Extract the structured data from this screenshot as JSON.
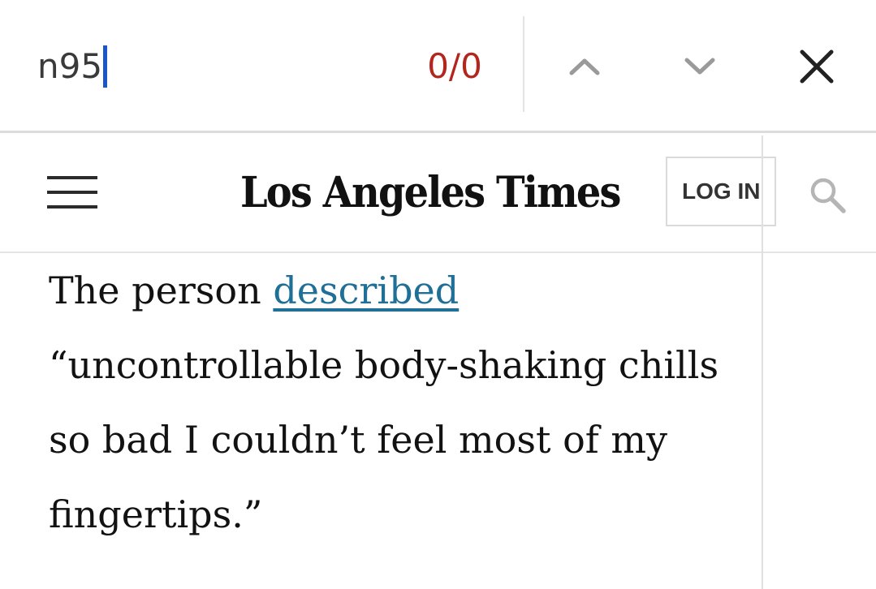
{
  "find_bar": {
    "query": "n95",
    "match_count": "0/0",
    "colors": {
      "caret": "#1a56c9",
      "match_count": "#b3261e"
    },
    "icons": {
      "previous": "chevron-up-icon",
      "next": "chevron-down-icon",
      "close": "close-icon"
    }
  },
  "site_header": {
    "masthead": "Los Angeles Times",
    "login_label": "LOG IN",
    "icons": {
      "menu": "hamburger-menu-icon",
      "search": "search-icon"
    }
  },
  "article": {
    "text_before_link": "The person ",
    "link_text": "described",
    "line2": "“uncontrollable body-shaking chills",
    "line3": "so bad I couldn’t feel most of my",
    "line4": "fingertips.”",
    "link_color": "#1f6f96"
  }
}
